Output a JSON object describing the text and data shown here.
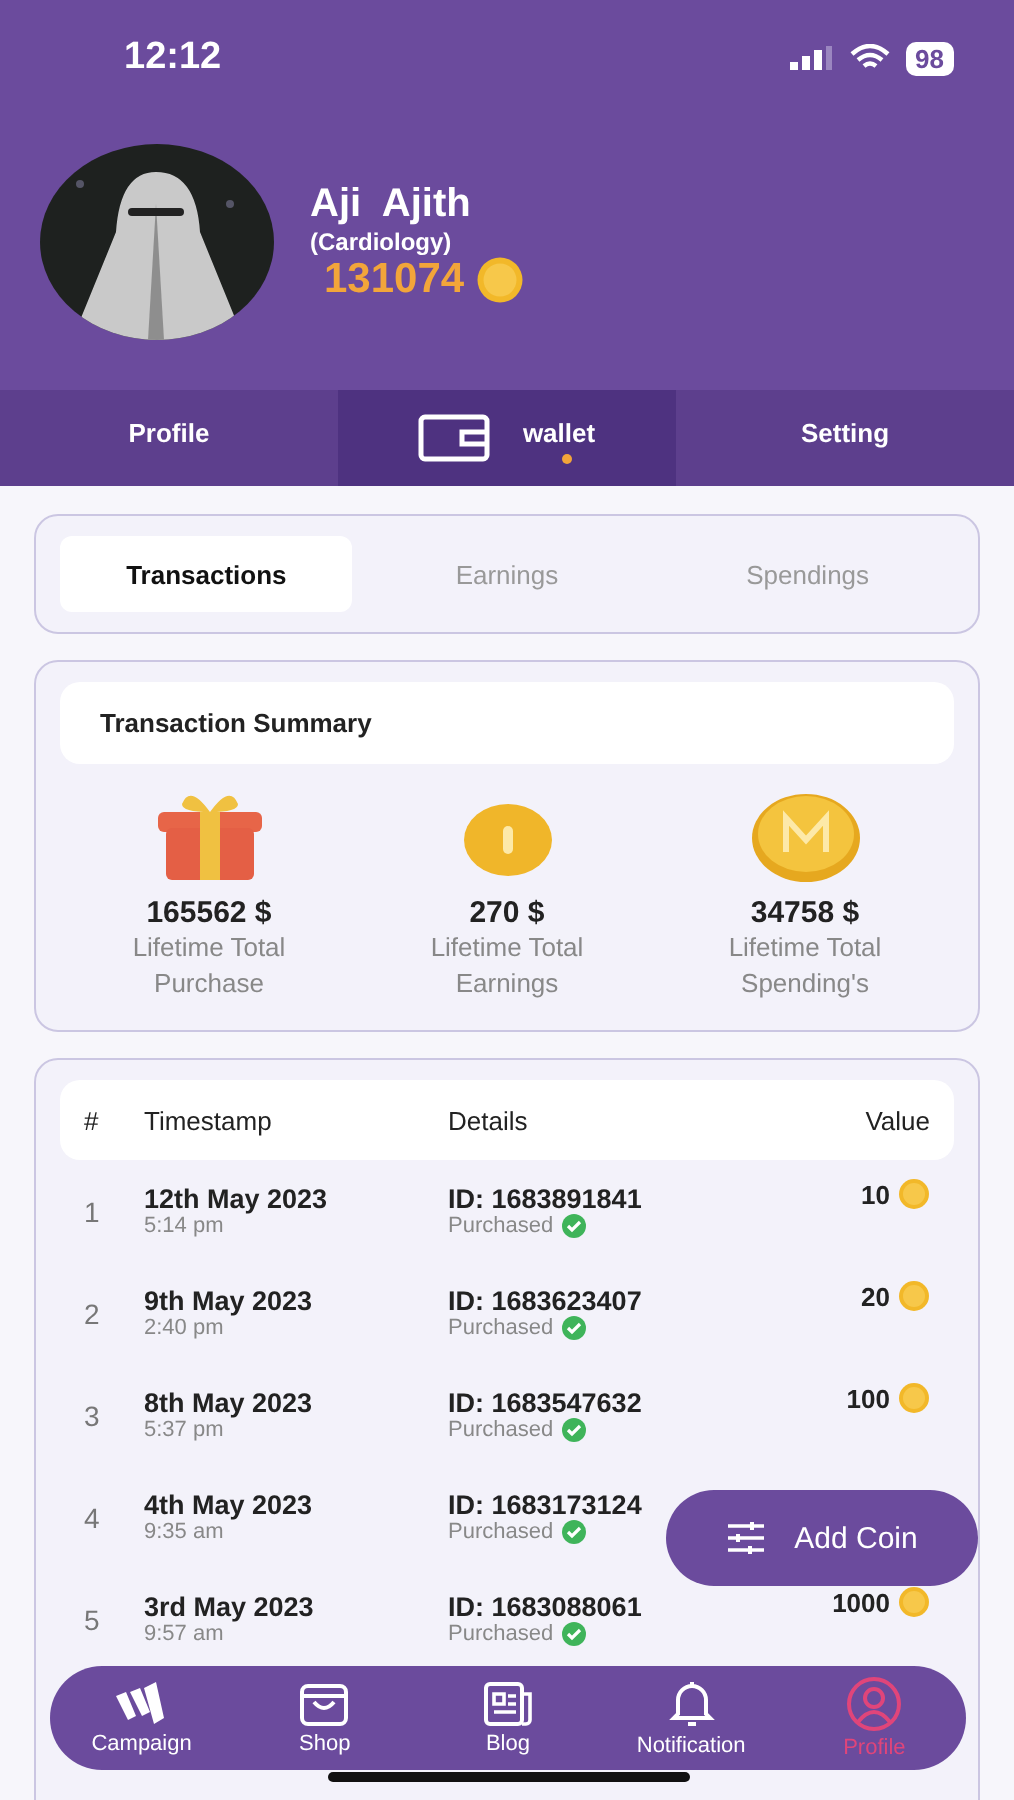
{
  "status_bar": {
    "time": "12:12",
    "battery": "98"
  },
  "profile": {
    "name": "Aji  Ajith",
    "department": "(Cardiology)",
    "coins": "131074"
  },
  "tabs": [
    {
      "label": "Profile",
      "selected": false,
      "kind": "text"
    },
    {
      "label": "wallet",
      "selected": true,
      "kind": "wallet"
    },
    {
      "label": "Setting",
      "selected": false,
      "kind": "text"
    }
  ],
  "segments": [
    {
      "label": "Transactions",
      "selected": true
    },
    {
      "label": "Earnings",
      "selected": false
    },
    {
      "label": "Spendings",
      "selected": false
    }
  ],
  "summary": {
    "title": "Transaction  Summary",
    "items": [
      {
        "kind": "gift",
        "amount": "165562 $",
        "label": "Lifetime Total Purchase"
      },
      {
        "kind": "coin",
        "amount": "270 $",
        "label": "Lifetime Total Earnings"
      },
      {
        "kind": "mcoin",
        "amount": "34758 $",
        "label": "Lifetime Total Spending's"
      }
    ]
  },
  "table": {
    "columns": [
      "#",
      "Timestamp",
      "Details",
      "Value"
    ],
    "rows": [
      {
        "index": "1",
        "date": "12th May 2023",
        "time": "5:14 pm",
        "id": "ID: 1683891841",
        "status": "Purchased",
        "value": "10"
      },
      {
        "index": "2",
        "date": "9th May 2023",
        "time": "2:40 pm",
        "id": "ID: 1683623407",
        "status": "Purchased",
        "value": "20"
      },
      {
        "index": "3",
        "date": "8th May 2023",
        "time": "5:37 pm",
        "id": "ID: 1683547632",
        "status": "Purchased",
        "value": "100"
      },
      {
        "index": "4",
        "date": "4th May 2023",
        "time": "9:35 am",
        "id": "ID: 1683173124",
        "status": "Purchased"
      },
      {
        "index": "5",
        "date": "3rd May 2023",
        "time": "9:57 am",
        "id": "ID: 1683088061",
        "status": "Purchased",
        "value": "1000"
      }
    ]
  },
  "add_button": {
    "label": "Add Coin"
  },
  "bottom_nav": [
    {
      "kind": "campaign",
      "label": "Campaign",
      "selected": false
    },
    {
      "kind": "shop",
      "label": "Shop",
      "selected": false
    },
    {
      "kind": "blog",
      "label": "Blog",
      "selected": false
    },
    {
      "kind": "notification",
      "label": "Notification",
      "selected": false
    },
    {
      "kind": "profile",
      "label": "Profile",
      "selected": true
    }
  ]
}
